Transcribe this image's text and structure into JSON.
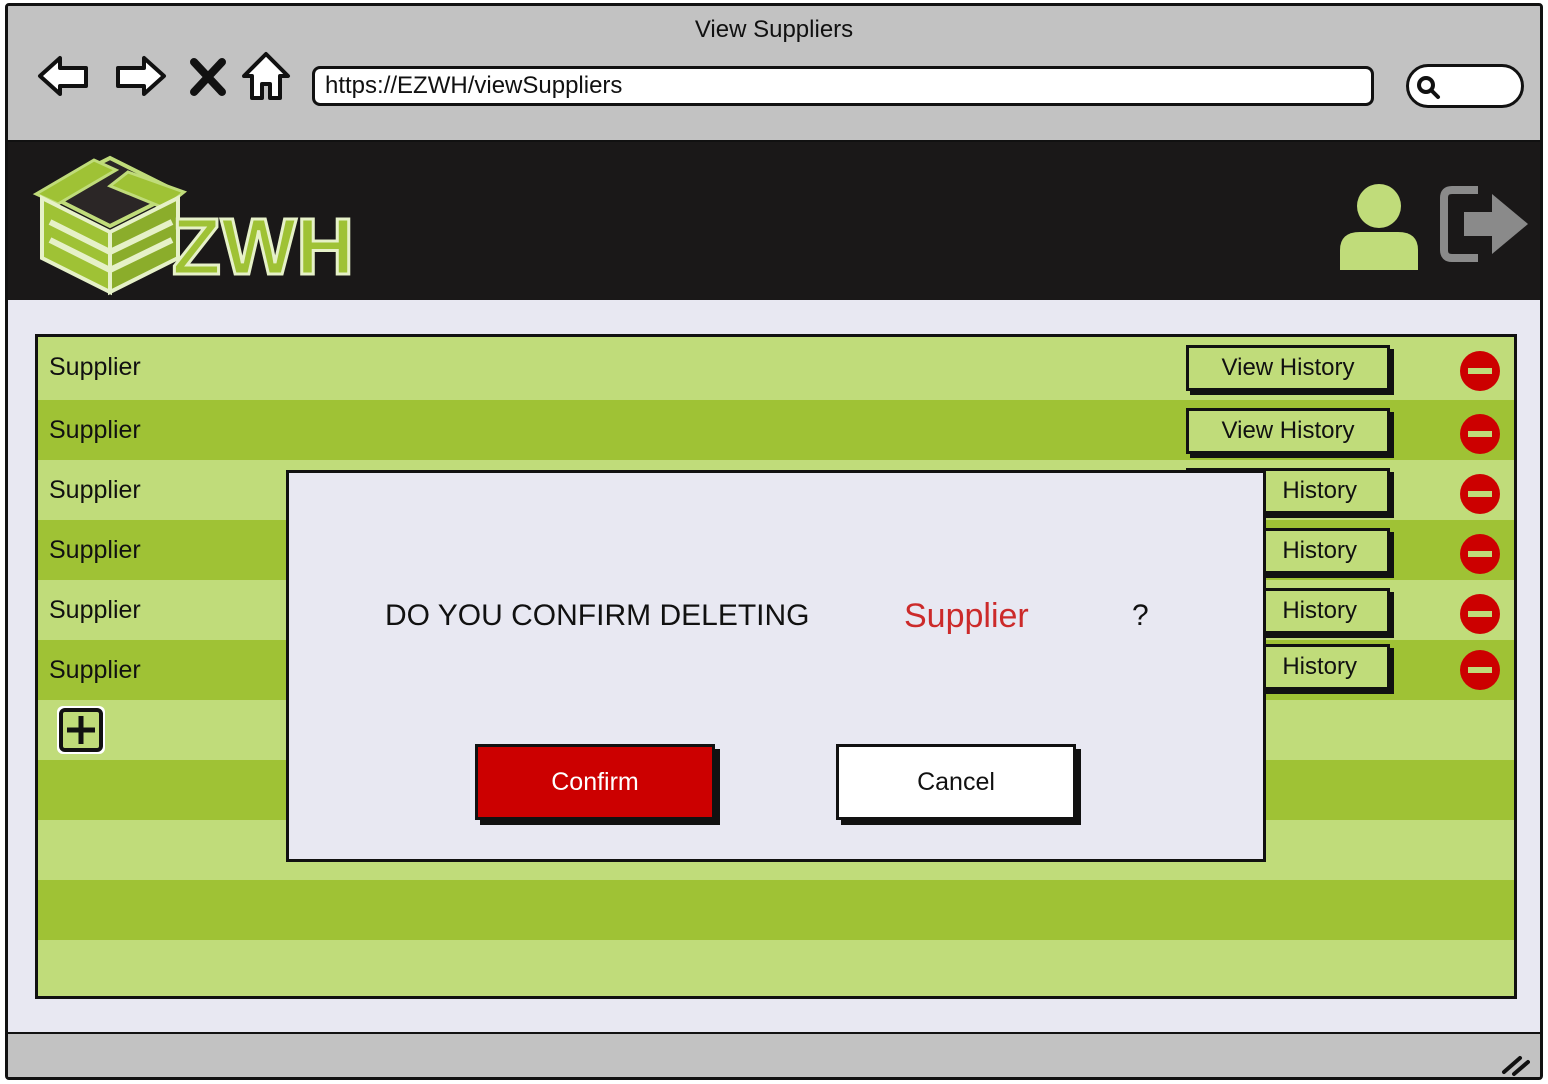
{
  "window": {
    "title": "View Suppliers"
  },
  "browser": {
    "url": "https://EZWH/viewSuppliers",
    "nav": [
      "back-icon",
      "forward-icon",
      "close-icon",
      "home-icon"
    ],
    "search_icon": "search-icon"
  },
  "header": {
    "logo_text": "ZWH",
    "user_icon": "user-icon",
    "logout_icon": "logout-icon"
  },
  "suppliers": {
    "items": [
      {
        "name": "Supplier",
        "action": "View History"
      },
      {
        "name": "Supplier",
        "action": "View History"
      },
      {
        "name": "Supplier",
        "action": "History"
      },
      {
        "name": "Supplier",
        "action": "History"
      },
      {
        "name": "Supplier",
        "action": "History"
      },
      {
        "name": "Supplier",
        "action": "History"
      }
    ],
    "add_icon": "plus-icon",
    "delete_icon": "minus-circle-icon"
  },
  "dialog": {
    "question": "DO YOU CONFIRM DELETING",
    "target": "Supplier",
    "mark": "?",
    "confirm_label": "Confirm",
    "cancel_label": "Cancel"
  },
  "colors": {
    "row_light": "#c0dc7a",
    "row_dark": "#9fc235",
    "brand_green": "#9fc235",
    "danger": "#cc0000",
    "header_bg": "#1a1818"
  }
}
